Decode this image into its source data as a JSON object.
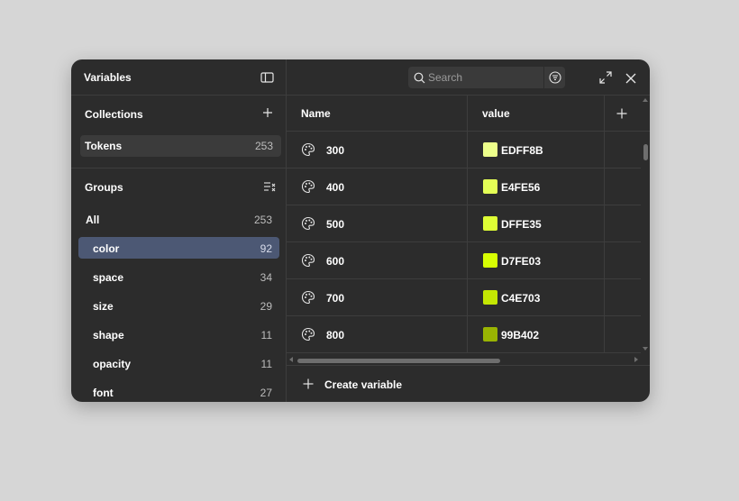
{
  "panel": {
    "title": "Variables",
    "sidebar_toggle_icon": "sidebar-panel-icon",
    "close_icon": "close-icon",
    "expand_icon": "expand-icon"
  },
  "collections": {
    "title": "Collections",
    "add_icon": "plus-icon",
    "items": [
      {
        "label": "Tokens",
        "count": "253"
      }
    ]
  },
  "groups": {
    "title": "Groups",
    "sort_icon": "sort-list-icon",
    "items": [
      {
        "label": "All",
        "count": "253"
      },
      {
        "label": "color",
        "count": "92"
      },
      {
        "label": "space",
        "count": "34"
      },
      {
        "label": "size",
        "count": "29"
      },
      {
        "label": "shape",
        "count": "11"
      },
      {
        "label": "opacity",
        "count": "11"
      },
      {
        "label": "font",
        "count": "27"
      }
    ],
    "selected": "color"
  },
  "search": {
    "placeholder": "Search",
    "value": ""
  },
  "table": {
    "columns": [
      "Name",
      "value"
    ],
    "rows": [
      {
        "name": "300",
        "value": "EDFF8B",
        "color": "#EDFF8B"
      },
      {
        "name": "400",
        "value": "E4FE56",
        "color": "#E4FE56"
      },
      {
        "name": "500",
        "value": "DFFE35",
        "color": "#DFFE35"
      },
      {
        "name": "600",
        "value": "D7FE03",
        "color": "#D7FE03"
      },
      {
        "name": "700",
        "value": "C4E703",
        "color": "#C4E703"
      },
      {
        "name": "800",
        "value": "99B402",
        "color": "#99B402"
      }
    ]
  },
  "footer": {
    "create_label": "Create variable"
  },
  "theme": {
    "background": "#2c2c2c",
    "selected": "#4c5874",
    "border": "#3d3d3d"
  }
}
